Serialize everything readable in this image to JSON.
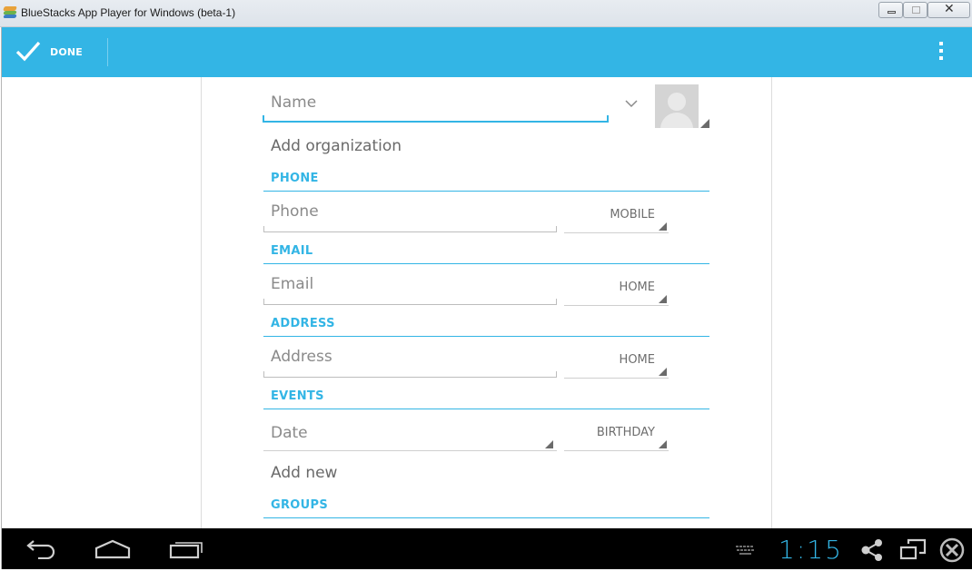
{
  "window": {
    "title": "BlueStacks App Player for Windows (beta-1)",
    "min_icon": "minimize-icon",
    "max_icon": "maximize-icon",
    "close_glyph": "✕"
  },
  "action_bar": {
    "done_label": "DONE",
    "accent_color": "#33b5e5",
    "done_icon": "checkmark-icon",
    "overflow_icon": "overflow-menu-icon"
  },
  "form": {
    "name_placeholder": "Name",
    "organization_label": "Add organization",
    "sections": {
      "phone": {
        "header": "PHONE",
        "placeholder": "Phone",
        "type": "MOBILE"
      },
      "email": {
        "header": "EMAIL",
        "placeholder": "Email",
        "type": "HOME"
      },
      "address": {
        "header": "ADDRESS",
        "placeholder": "Address",
        "type": "HOME"
      },
      "events": {
        "header": "EVENTS",
        "placeholder": "Date",
        "type": "BIRTHDAY",
        "add_new": "Add new"
      },
      "groups": {
        "header": "GROUPS"
      }
    }
  },
  "status": {
    "time": "1:15",
    "clock_color": "#33b5e5"
  }
}
